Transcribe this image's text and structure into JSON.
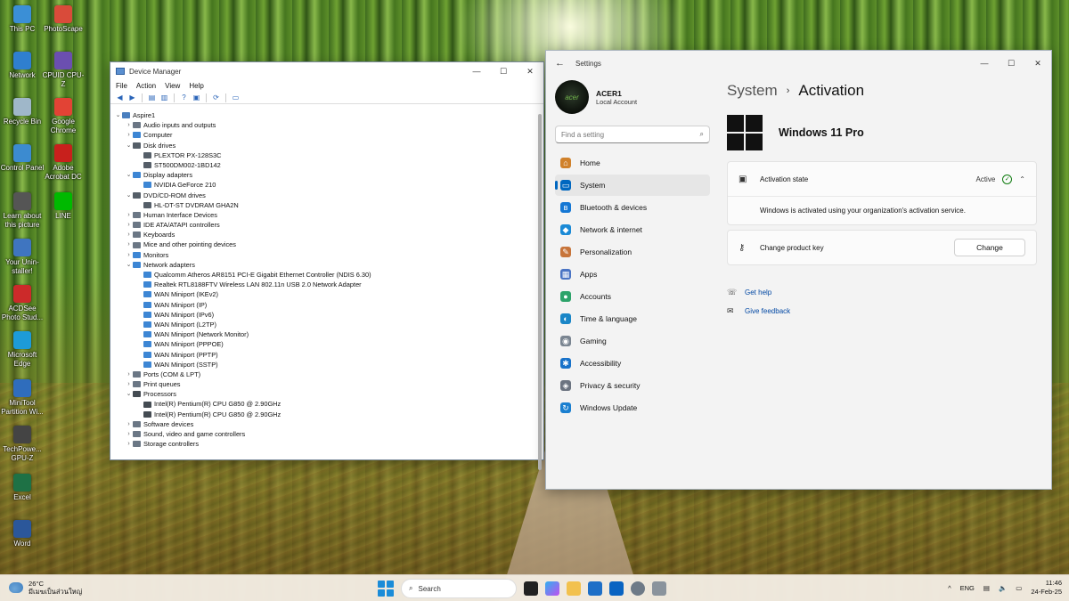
{
  "desktop": {
    "icons": [
      {
        "label": "This PC",
        "color": "#3b8fd6"
      },
      {
        "label": "PhotoScape",
        "color": "#d94b3a"
      },
      {
        "label": "Network",
        "color": "#2f7fcf"
      },
      {
        "label": "CPUID CPU-Z",
        "color": "#6b4fb0"
      },
      {
        "label": "Recycle Bin",
        "color": "#9fb7c9"
      },
      {
        "label": "Google Chrome",
        "color": "#e24335"
      },
      {
        "label": "Control Panel",
        "color": "#3c8bd0"
      },
      {
        "label": "Adobe Acrobat DC",
        "color": "#c8201c"
      },
      {
        "label": "Learn about this picture",
        "color": "#555555"
      },
      {
        "label": "LINE",
        "color": "#00b900"
      },
      {
        "label": "Your Unin-staller!",
        "color": "#3f75c0"
      },
      {
        "label": "ACDSee Photo Stud...",
        "color": "#cc2a2a"
      },
      {
        "label": "Microsoft Edge",
        "color": "#1d9bd8"
      },
      {
        "label": "MiniTool Partition Wi...",
        "color": "#2f6dbc"
      },
      {
        "label": "TechPowe... GPU-Z",
        "color": "#444444"
      },
      {
        "label": "Excel",
        "color": "#1e7145"
      },
      {
        "label": "Word",
        "color": "#2b579a"
      }
    ]
  },
  "device_manager": {
    "title": "Device Manager",
    "menu": [
      "File",
      "Action",
      "View",
      "Help"
    ],
    "tree": [
      {
        "text": "Aspire1",
        "level": 0,
        "exp": "⌄",
        "color": "#4a7fbf"
      },
      {
        "text": "Audio inputs and outputs",
        "level": 1,
        "exp": "›",
        "color": "#6b7785"
      },
      {
        "text": "Computer",
        "level": 1,
        "exp": "›",
        "color": "#3d86d4"
      },
      {
        "text": "Disk drives",
        "level": 1,
        "exp": "⌄",
        "color": "#555e68"
      },
      {
        "text": "PLEXTOR PX-128S3C",
        "level": 2,
        "exp": "",
        "color": "#555e68"
      },
      {
        "text": "ST500DM002-1BD142",
        "level": 2,
        "exp": "",
        "color": "#555e68"
      },
      {
        "text": "Display adapters",
        "level": 1,
        "exp": "⌄",
        "color": "#3d86d4"
      },
      {
        "text": "NVIDIA GeForce 210",
        "level": 2,
        "exp": "",
        "color": "#3d86d4"
      },
      {
        "text": "DVD/CD-ROM drives",
        "level": 1,
        "exp": "⌄",
        "color": "#555e68"
      },
      {
        "text": "HL-DT-ST DVDRAM GHA2N",
        "level": 2,
        "exp": "",
        "color": "#555e68"
      },
      {
        "text": "Human Interface Devices",
        "level": 1,
        "exp": "›",
        "color": "#6b7785"
      },
      {
        "text": "IDE ATA/ATAPI controllers",
        "level": 1,
        "exp": "›",
        "color": "#6b7785"
      },
      {
        "text": "Keyboards",
        "level": 1,
        "exp": "›",
        "color": "#6b7785"
      },
      {
        "text": "Mice and other pointing devices",
        "level": 1,
        "exp": "›",
        "color": "#6b7785"
      },
      {
        "text": "Monitors",
        "level": 1,
        "exp": "›",
        "color": "#3d86d4"
      },
      {
        "text": "Network adapters",
        "level": 1,
        "exp": "⌄",
        "color": "#3d86d4"
      },
      {
        "text": "Qualcomm Atheros AR8151 PCI-E Gigabit Ethernet Controller (NDIS 6.30)",
        "level": 2,
        "exp": "",
        "color": "#3d86d4"
      },
      {
        "text": "Realtek RTL8188FTV Wireless LAN 802.11n USB 2.0 Network Adapter",
        "level": 2,
        "exp": "",
        "color": "#3d86d4"
      },
      {
        "text": "WAN Miniport (IKEv2)",
        "level": 2,
        "exp": "",
        "color": "#3d86d4"
      },
      {
        "text": "WAN Miniport (IP)",
        "level": 2,
        "exp": "",
        "color": "#3d86d4"
      },
      {
        "text": "WAN Miniport (IPv6)",
        "level": 2,
        "exp": "",
        "color": "#3d86d4"
      },
      {
        "text": "WAN Miniport (L2TP)",
        "level": 2,
        "exp": "",
        "color": "#3d86d4"
      },
      {
        "text": "WAN Miniport (Network Monitor)",
        "level": 2,
        "exp": "",
        "color": "#3d86d4"
      },
      {
        "text": "WAN Miniport (PPPOE)",
        "level": 2,
        "exp": "",
        "color": "#3d86d4"
      },
      {
        "text": "WAN Miniport (PPTP)",
        "level": 2,
        "exp": "",
        "color": "#3d86d4"
      },
      {
        "text": "WAN Miniport (SSTP)",
        "level": 2,
        "exp": "",
        "color": "#3d86d4"
      },
      {
        "text": "Ports (COM & LPT)",
        "level": 1,
        "exp": "›",
        "color": "#6b7785"
      },
      {
        "text": "Print queues",
        "level": 1,
        "exp": "›",
        "color": "#6b7785"
      },
      {
        "text": "Processors",
        "level": 1,
        "exp": "⌄",
        "color": "#444b52"
      },
      {
        "text": "Intel(R) Pentium(R) CPU G850 @ 2.90GHz",
        "level": 2,
        "exp": "",
        "color": "#444b52"
      },
      {
        "text": "Intel(R) Pentium(R) CPU G850 @ 2.90GHz",
        "level": 2,
        "exp": "",
        "color": "#444b52"
      },
      {
        "text": "Software devices",
        "level": 1,
        "exp": "›",
        "color": "#6b7785"
      },
      {
        "text": "Sound, video and game controllers",
        "level": 1,
        "exp": "›",
        "color": "#6b7785"
      },
      {
        "text": "Storage controllers",
        "level": 1,
        "exp": "›",
        "color": "#6b7785"
      }
    ]
  },
  "settings": {
    "title": "Settings",
    "profile": {
      "name": "ACER1",
      "sub": "Local Account",
      "avatar_text": "acer"
    },
    "search_placeholder": "Find a setting",
    "nav": [
      {
        "label": "Home",
        "icon": "home-icon",
        "glyph": "⌂",
        "color": "#d0812b"
      },
      {
        "label": "System",
        "icon": "system-icon",
        "glyph": "▭",
        "color": "#0067c0",
        "active": true
      },
      {
        "label": "Bluetooth & devices",
        "icon": "bluetooth-icon",
        "glyph": "ʙ",
        "color": "#1477d4"
      },
      {
        "label": "Network & internet",
        "icon": "wifi-icon",
        "glyph": "◆",
        "color": "#1b8ad6"
      },
      {
        "label": "Personalization",
        "icon": "brush-icon",
        "glyph": "✎",
        "color": "#c7743a"
      },
      {
        "label": "Apps",
        "icon": "apps-icon",
        "glyph": "▦",
        "color": "#4a74c4"
      },
      {
        "label": "Accounts",
        "icon": "accounts-icon",
        "glyph": "●",
        "color": "#2da36a"
      },
      {
        "label": "Time & language",
        "icon": "globe-icon",
        "glyph": "◐",
        "color": "#1a86c7"
      },
      {
        "label": "Gaming",
        "icon": "gaming-icon",
        "glyph": "◉",
        "color": "#7a8591"
      },
      {
        "label": "Accessibility",
        "icon": "accessibility-icon",
        "glyph": "✱",
        "color": "#1872c9"
      },
      {
        "label": "Privacy & security",
        "icon": "shield-icon",
        "glyph": "◈",
        "color": "#6b7380"
      },
      {
        "label": "Windows Update",
        "icon": "update-icon",
        "glyph": "↻",
        "color": "#1a7fd0"
      }
    ],
    "breadcrumb_parent": "System",
    "breadcrumb_sep": "›",
    "page_title": "Activation",
    "edition": "Windows 11 Pro",
    "activation_label": "Activation state",
    "activation_value": "Active",
    "activation_message": "Windows is activated using your organization's activation service.",
    "product_key_label": "Change product key",
    "change_button": "Change",
    "help_link": "Get help",
    "feedback_link": "Give feedback"
  },
  "taskbar": {
    "temperature": "26°C",
    "weather_text": "มีเมฆเป็นส่วนใหญ่",
    "search_label": "Search",
    "language": "ENG",
    "time": "11:46",
    "date": "24-Feb-25",
    "tray_arrow": "^"
  }
}
